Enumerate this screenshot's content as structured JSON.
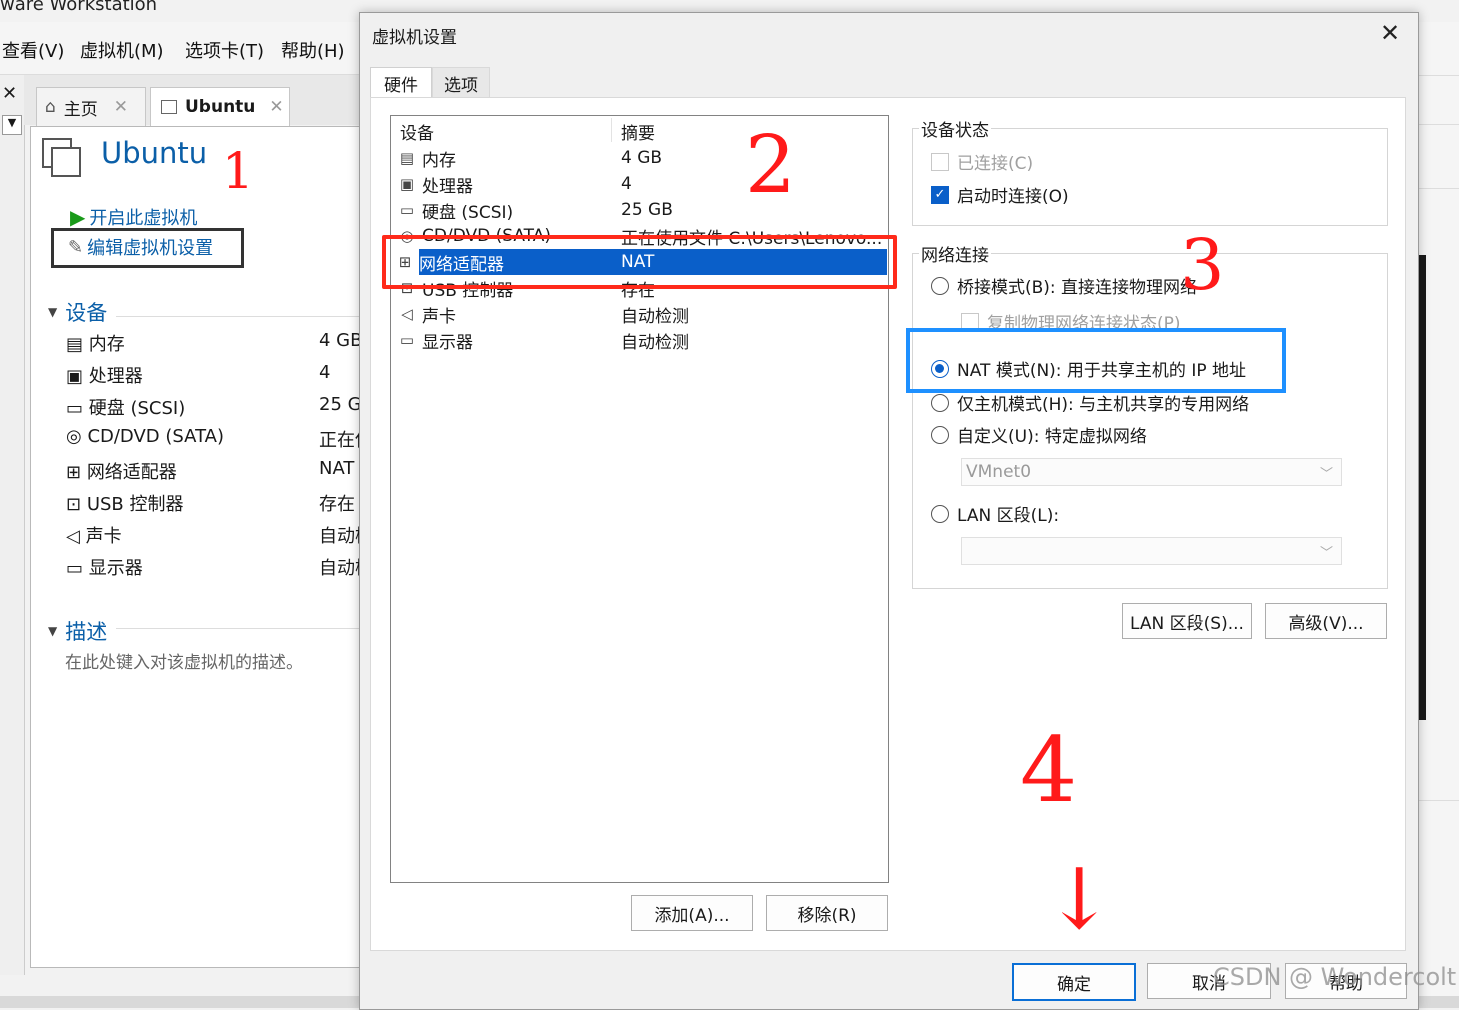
{
  "app": {
    "title_partial": "ware Workstation",
    "menu": [
      "查看(V)",
      "虚拟机(M)",
      "选项卡(T)",
      "帮助(H)"
    ],
    "tabs": [
      {
        "label": "主页"
      },
      {
        "label": "Ubuntu"
      }
    ]
  },
  "vm": {
    "name": "Ubuntu",
    "actions": {
      "power_on": "开启此虚拟机",
      "edit_settings": "编辑虚拟机设置"
    },
    "devices_heading": "设备",
    "devices": [
      {
        "name": "内存",
        "value": "4 GB",
        "icon": "memory-icon"
      },
      {
        "name": "处理器",
        "value": "4",
        "icon": "cpu-icon"
      },
      {
        "name": "硬盘 (SCSI)",
        "value": "25 G",
        "icon": "harddisk-icon"
      },
      {
        "name": "CD/DVD (SATA)",
        "value": "正在使",
        "icon": "cd-icon"
      },
      {
        "name": "网络适配器",
        "value": "NAT",
        "icon": "network-icon"
      },
      {
        "name": "USB 控制器",
        "value": "存在",
        "icon": "usb-icon"
      },
      {
        "name": "声卡",
        "value": "自动检",
        "icon": "sound-icon"
      },
      {
        "name": "显示器",
        "value": "自动检",
        "icon": "monitor-icon"
      }
    ],
    "description_heading": "描述",
    "description_placeholder": "在此处键入对该虚拟机的描述。"
  },
  "dialog": {
    "title": "虚拟机设置",
    "tabs": [
      "硬件",
      "选项"
    ],
    "list_headers": {
      "device": "设备",
      "summary": "摘要"
    },
    "devices": [
      {
        "name": "内存",
        "summary": "4 GB"
      },
      {
        "name": "处理器",
        "summary": "4"
      },
      {
        "name": "硬盘 (SCSI)",
        "summary": "25 GB"
      },
      {
        "name": "CD/DVD (SATA)",
        "summary": "正在使用文件 C:\\Users\\Lenovo..."
      },
      {
        "name": "网络适配器",
        "summary": "NAT"
      },
      {
        "name": "USB 控制器",
        "summary": "存在"
      },
      {
        "name": "声卡",
        "summary": "自动检测"
      },
      {
        "name": "显示器",
        "summary": "自动检测"
      }
    ],
    "selected_device": "网络适配器",
    "add_button": "添加(A)...",
    "remove_button": "移除(R)",
    "device_status": {
      "legend": "设备状态",
      "connected": "已连接(C)",
      "connect_on_poweron": "启动时连接(O)"
    },
    "network": {
      "legend": "网络连接",
      "bridged": "桥接模式(B): 直接连接物理网络",
      "replicate": "复制物理网络连接状态(P)",
      "nat": "NAT 模式(N): 用于共享主机的 IP 地址",
      "hostonly": "仅主机模式(H): 与主机共享的专用网络",
      "custom": "自定义(U): 特定虚拟网络",
      "custom_value": "VMnet0",
      "lan": "LAN 区段(L):",
      "lan_value": ""
    },
    "lan_segments_button": "LAN 区段(S)...",
    "advanced_button": "高级(V)...",
    "ok_button": "确定",
    "cancel_button": "取消",
    "help_button": "帮助"
  },
  "annotations": {
    "step1": "1",
    "step2": "2",
    "step3": "3",
    "step4": "4",
    "arrow": "↓"
  },
  "watermark": "CSDN @ Wondercolt",
  "colors": {
    "selection": "#0a5fc9",
    "link": "#0b5fa8",
    "red_box": "#ff2a1a",
    "blue_box": "#1e90ff",
    "dark_box": "#333333"
  }
}
